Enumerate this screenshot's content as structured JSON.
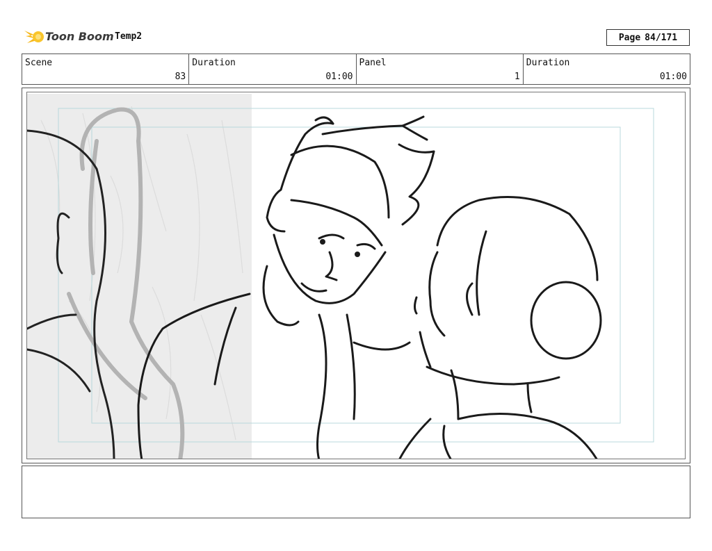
{
  "header": {
    "brand": "Toon Boom",
    "project_title": "Temp2",
    "page_label": "Page",
    "page_value": "84/171"
  },
  "info": [
    {
      "label": "Scene",
      "value": "83"
    },
    {
      "label": "Duration",
      "value": "01:00"
    },
    {
      "label": "Panel",
      "value": "1"
    },
    {
      "label": "Duration",
      "value": "01:00"
    }
  ],
  "panel": {
    "image": "storyboard-sketch",
    "icon": "toon-boom-logo-icon"
  },
  "notes": {
    "text": ""
  }
}
